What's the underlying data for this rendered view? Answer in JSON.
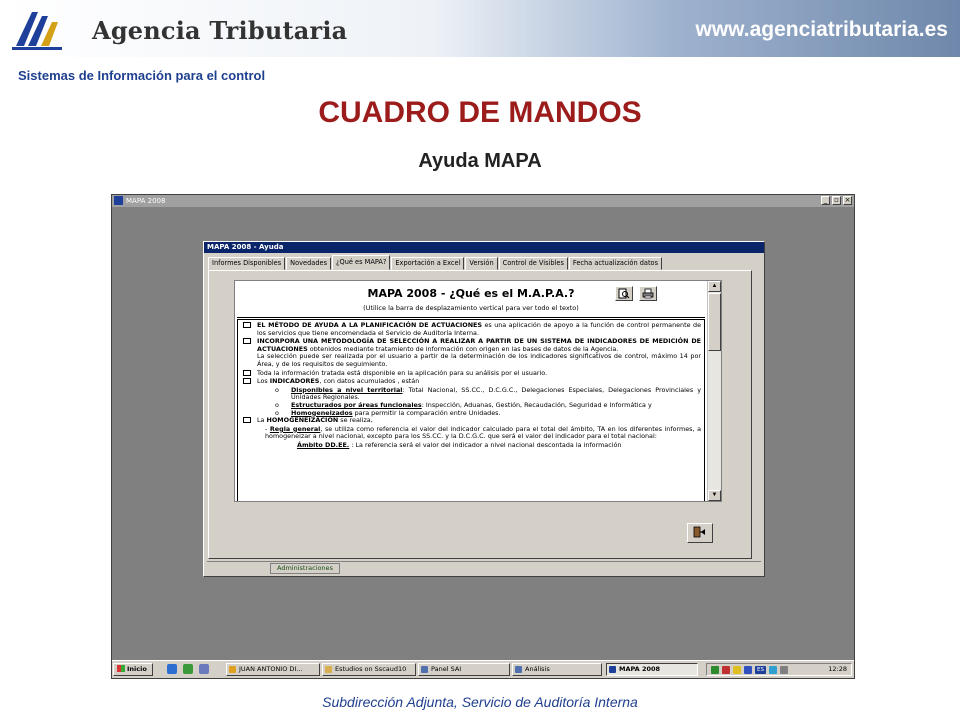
{
  "header": {
    "agency_name": "Agencia Tributaria",
    "site_url": "www.agenciatributaria.es"
  },
  "subtitle": "Sistemas de Información para el control",
  "title": "CUADRO DE MANDOS",
  "subheading": "Ayuda MAPA",
  "footer": "Subdirección Adjunta, Servicio de Auditoría Interna",
  "app_window": {
    "title": "MAPA 2008",
    "controls": {
      "minimize": "_",
      "restore": "▫",
      "close": "×"
    }
  },
  "dialog": {
    "title": "MAPA 2008 - Ayuda",
    "tabs": [
      {
        "label": "Informes Disponibles"
      },
      {
        "label": "Novedades"
      },
      {
        "label": "¿Qué es MAPA?"
      },
      {
        "label": "Exportación a Excel"
      },
      {
        "label": "Versión"
      },
      {
        "label": "Control de Visibles"
      },
      {
        "label": "Fecha  actualización datos"
      }
    ],
    "active_tab": "¿Qué es MAPA?",
    "bottom_tab": "Administraciones"
  },
  "doc": {
    "title": "MAPA 2008 - ¿Qué es el M.A.P.A.?",
    "subtitle": "(Utilice la barra de desplazamiento vertical para ver todo el texto)",
    "p1_bold": "EL MÉTODO DE AYUDA A LA PLANIFICACIÓN DE ACTUACIONES",
    "p1_text": " es una aplicación de apoyo a la función de control permanente de los servicios que tiene encomendada el Servicio de Auditoría Interna.",
    "p2_bold": "INCORPORA UNA METODOLOGÍA DE SELECCIÓN A REALIZAR A PARTIR DE UN SISTEMA DE INDICADORES DE MEDICIÓN DE ACTUACIONES",
    "p2_text": " obtenidos mediante tratamiento de información con origen en las bases de datos de la Agencia.",
    "p2_extra": "La selección puede ser realizada por el usuario a partir de la determinación de los indicadores significativos de control, máximo 14 por Área, y de los requisitos de seguimiento.",
    "p3_text": "Toda la información tratada está disponible en la aplicación para su análisis por el usuario.",
    "p4_pre": "Los ",
    "p4_bold": "INDICADORES",
    "p4_text": ", con datos acumulados , están",
    "sub1_u": "Disponibles a nivel territorial",
    "sub1_text": ": Total Nacional, SS.CC., D.C.G.C., Delegaciones Especiales, Delegaciones Provinciales y Unidades Regionales.",
    "sub2_u": "Estructurados por áreas funcionales",
    "sub2_text": ": Inspección, Aduanas, Gestión, Recaudación, Seguridad e Informática y",
    "sub3_u": "Homogeneizados",
    "sub3_text": " para permitir la comparación entre Unidades.",
    "p5_pre": "La ",
    "p5_bold": "HOMOGENEIZACIÓN",
    "p5_text": " se realiza,",
    "p5_item_pre": "- ",
    "p5_item_u": "Regla general",
    "p5_item_text": ", se utiliza como referencia el valor del indicador calculado para el total del ámbito, TA en los diferentes informes,  a homogeneizar a nivel nacional, excepto para los SS.CC. y la D.C.G.C. que será el valor del indicador para el total nacional:",
    "p5_cut_u": "Ámbito DD.EE.",
    "p5_cut_text": " : La referencia será el valor del indicador a nivel nacional descontada la información",
    "bullet_char": "o"
  },
  "taskbar": {
    "start": "Inicio",
    "buttons": [
      {
        "label": "JUAN ANTONIO DI...",
        "active": false
      },
      {
        "label": "Estudios on Sscaud10",
        "active": false
      },
      {
        "label": "Panel SAI",
        "active": false
      },
      {
        "label": "Análisis",
        "active": false
      },
      {
        "label": "MAPA  2008",
        "active": true
      }
    ],
    "tray_lang": "ES",
    "clock": "12:28"
  },
  "colors": {
    "title_red": "#9c1c1c",
    "subtitle_blue": "#1f3f8f",
    "dialog_title_blue": "#0a246a",
    "win_gray": "#d4d0c8"
  },
  "icons": {
    "agency_logo": "agencia-tributaria-logo",
    "doc_preview": "print-preview-icon",
    "doc_print": "printer-icon",
    "exit": "exit-door-icon"
  }
}
